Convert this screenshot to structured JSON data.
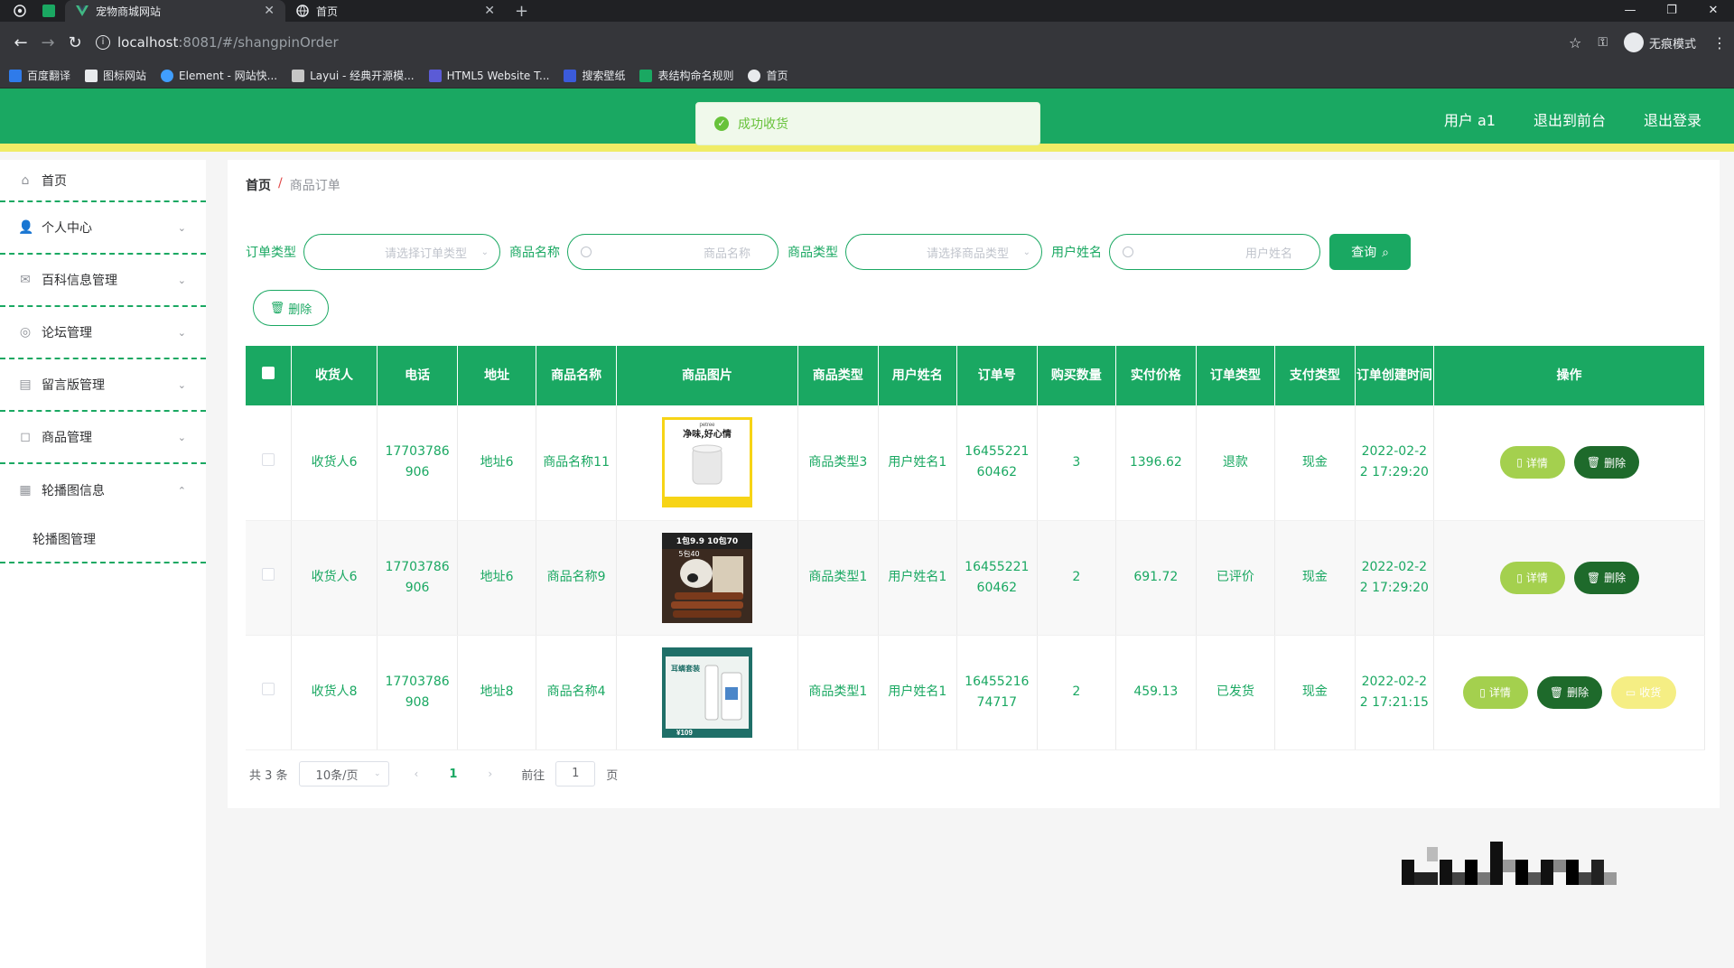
{
  "browser": {
    "tabs": [
      {
        "title": "宠物商城网站",
        "active": true
      },
      {
        "title": "首页",
        "active": false
      }
    ],
    "url_host": "localhost",
    "url_path": ":8081/#/shangpinOrder",
    "incognito_label": "无痕模式",
    "bookmarks": [
      "百度翻译",
      "图标网站",
      "Element - 网站快...",
      "Layui - 经典开源模...",
      "HTML5 Website T...",
      "搜索壁纸",
      "表结构命名规则",
      "首页"
    ]
  },
  "header": {
    "user": "用户 a1",
    "back_front": "退出到前台",
    "logout": "退出登录"
  },
  "toast": {
    "message": "成功收货"
  },
  "sidebar": {
    "items": [
      {
        "label": "首页",
        "icon": "home-icon"
      },
      {
        "label": "个人中心",
        "icon": "user-icon"
      },
      {
        "label": "百科信息管理",
        "icon": "mail-icon"
      },
      {
        "label": "论坛管理",
        "icon": "forum-icon"
      },
      {
        "label": "留言版管理",
        "icon": "message-icon"
      },
      {
        "label": "商品管理",
        "icon": "goods-icon"
      },
      {
        "label": "轮播图信息",
        "icon": "grid-icon"
      }
    ],
    "sub_item": "轮播图管理"
  },
  "breadcrumb": {
    "home": "首页",
    "separator": "/",
    "current": "商品订单"
  },
  "filters": {
    "order_type_label": "订单类型",
    "order_type_placeholder": "请选择订单类型",
    "product_name_label": "商品名称",
    "product_name_placeholder": "商品名称",
    "product_type_label": "商品类型",
    "product_type_placeholder": "请选择商品类型",
    "user_name_label": "用户姓名",
    "user_name_placeholder": "用户姓名",
    "query_button": "查询"
  },
  "delete_button": "删除",
  "table": {
    "headers": [
      "收货人",
      "电话",
      "地址",
      "商品名称",
      "商品图片",
      "商品类型",
      "用户姓名",
      "订单号",
      "购买数量",
      "实付价格",
      "订单类型",
      "支付类型",
      "订单创建时间",
      "操作"
    ],
    "rows": [
      {
        "receiver": "收货人6",
        "phone": "17703786906",
        "address": "地址6",
        "product": "商品名称11",
        "type": "商品类型3",
        "user": "用户姓名1",
        "order_no": "1645522160462",
        "qty": "3",
        "price": "1396.62",
        "order_type": "退款",
        "pay_type": "现金",
        "created": "2022-02-22 17:29:20"
      },
      {
        "receiver": "收货人6",
        "phone": "17703786906",
        "address": "地址6",
        "product": "商品名称9",
        "type": "商品类型1",
        "user": "用户姓名1",
        "order_no": "1645522160462",
        "qty": "2",
        "price": "691.72",
        "order_type": "已评价",
        "pay_type": "现金",
        "created": "2022-02-22 17:29:20"
      },
      {
        "receiver": "收货人8",
        "phone": "17703786908",
        "address": "地址8",
        "product": "商品名称4",
        "type": "商品类型1",
        "user": "用户姓名1",
        "order_no": "1645521674717",
        "qty": "2",
        "price": "459.13",
        "order_type": "已发货",
        "pay_type": "现金",
        "created": "2022-02-22 17:21:15"
      }
    ],
    "ops": {
      "detail": "详情",
      "delete": "删除",
      "receive": "收货"
    },
    "image_texts": {
      "img1_brand": "petree",
      "img1_top": "净味,好心情",
      "img2_top": "1包9.9 10包70",
      "img2_sub": "5包40",
      "img3_top": "耳螨套装",
      "img3_price": "¥109"
    }
  },
  "pager": {
    "total": "共 3 条",
    "page_size": "10条/页",
    "current_page": "1",
    "goto_label": "前往",
    "goto_value": "1",
    "page_unit": "页"
  },
  "colors": {
    "primary": "#1aa862",
    "accent_yellow": "#f0ec66",
    "detail": "#a4d04e",
    "delete": "#1e6a2b",
    "receive": "#f5ee84"
  }
}
